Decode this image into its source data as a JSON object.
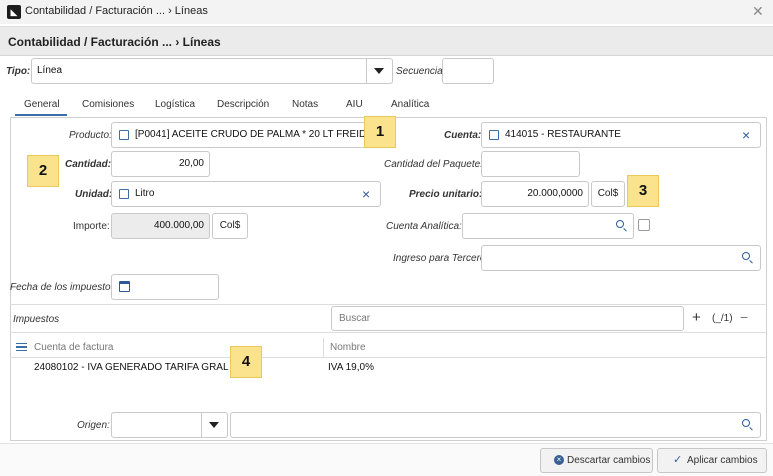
{
  "window": {
    "title": "Contabilidad / Facturación ... › Líneas"
  },
  "header": {
    "title": "Contabilidad / Facturación ... › Líneas"
  },
  "top": {
    "tipo_label": "Tipo:",
    "tipo_value": "Línea",
    "secuencia_label": "Secuencia:",
    "secuencia_value": ""
  },
  "tabs": [
    "General",
    "Comisiones",
    "Logística",
    "Descripción",
    "Notas",
    "AIU",
    "Analítica"
  ],
  "form": {
    "producto_label": "Producto:",
    "producto_value": "[P0041] ACEITE CRUDO DE PALMA * 20 LT FREIDORA",
    "cuenta_label": "Cuenta:",
    "cuenta_value": "414015 - RESTAURANTE",
    "cantidad_label": "Cantidad:",
    "cantidad_value": "20,00",
    "cantidad_paquete_label": "Cantidad del Paquete:",
    "cantidad_paquete_value": "",
    "unidad_label": "Unidad:",
    "unidad_value": "Litro",
    "precio_label": "Precio unitario:",
    "precio_value": "20.000,0000",
    "precio_currency": "Col$",
    "importe_label": "Importe:",
    "importe_value": "400.000,00",
    "importe_currency": "Col$",
    "cuenta_analitica_label": "Cuenta Analítica:",
    "cuenta_analitica_value": "",
    "ingreso_tercero_label": "Ingreso para Tercero:",
    "ingreso_tercero_value": "",
    "fecha_impuestos_label": "Fecha de los impuestos:",
    "fecha_impuestos_value": ""
  },
  "impuestos": {
    "label": "Impuestos",
    "search_placeholder": "Buscar",
    "add": "+",
    "pager": "(_/1)",
    "remove": "−",
    "columns": [
      "Cuenta de factura",
      "Nombre"
    ],
    "rows": [
      {
        "cuenta": "24080102 - IVA GENERADO TARIFA GRAL",
        "nombre": "IVA 19,0%"
      }
    ]
  },
  "origen": {
    "label": "Origen:",
    "value": "",
    "search_value": ""
  },
  "footer": {
    "discard_label": "Descartar cambios",
    "apply_label": "Aplicar cambios"
  },
  "callouts": [
    "1",
    "2",
    "3",
    "4"
  ],
  "icons": {
    "app": "app-logo-icon",
    "close": "close-icon",
    "external": "external-link-icon",
    "clear": "clear-x-icon",
    "search": "search-icon",
    "calendar": "calendar-icon",
    "dropdown": "dropdown-arrow-icon",
    "menu": "hamburger-menu-icon",
    "discard": "discard-icon",
    "check": "check-icon"
  },
  "colors": {
    "accent_blue": "#2b5a9a",
    "callout_yellow": "#fbe38e",
    "tab_underline": "#3a6ea5"
  }
}
